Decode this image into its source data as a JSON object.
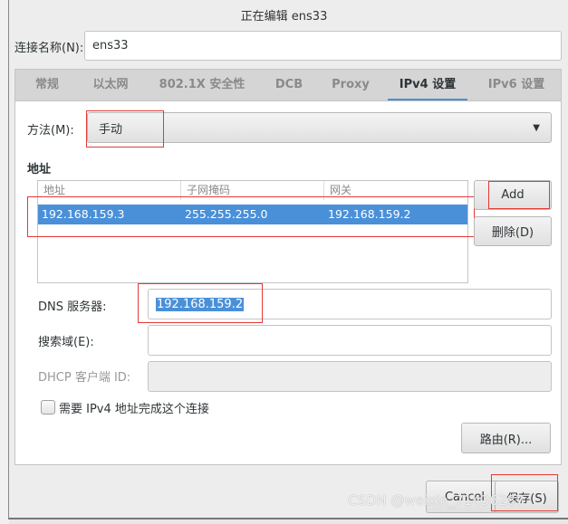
{
  "window": {
    "title": "正在编辑 ens33"
  },
  "connection_name": {
    "label": "连接名称(N):",
    "value": "ens33"
  },
  "tabs": [
    {
      "label": "常规"
    },
    {
      "label": "以太网"
    },
    {
      "label": "802.1X 安全性"
    },
    {
      "label": "DCB"
    },
    {
      "label": "Proxy"
    },
    {
      "label": "IPv4 设置",
      "active": true
    },
    {
      "label": "IPv6 设置"
    }
  ],
  "method": {
    "label": "方法(M):",
    "value": "手动"
  },
  "addresses": {
    "section_title": "地址",
    "columns": [
      "地址",
      "子网掩码",
      "网关"
    ],
    "rows": [
      [
        "192.168.159.3",
        "255.255.255.0",
        "192.168.159.2"
      ]
    ],
    "add_label": "Add",
    "delete_label": "删除(D)"
  },
  "dns": {
    "label": "DNS 服务器:",
    "value": "192.168.159.2"
  },
  "search_domain": {
    "label": "搜索域(E):",
    "value": ""
  },
  "dhcp_client_id": {
    "label": "DHCP 客户端 ID:",
    "value": ""
  },
  "require_ipv4": {
    "label": "需要 IPv4 地址完成这个连接",
    "checked": false
  },
  "routes_label": "路由(R)...",
  "footer": {
    "cancel_label": "Cancel",
    "save_label": "保存(S)"
  },
  "watermark": "CSDN @weixin_71436287",
  "colors": {
    "accent": "#4a90d9",
    "annotation": "#e53935"
  }
}
